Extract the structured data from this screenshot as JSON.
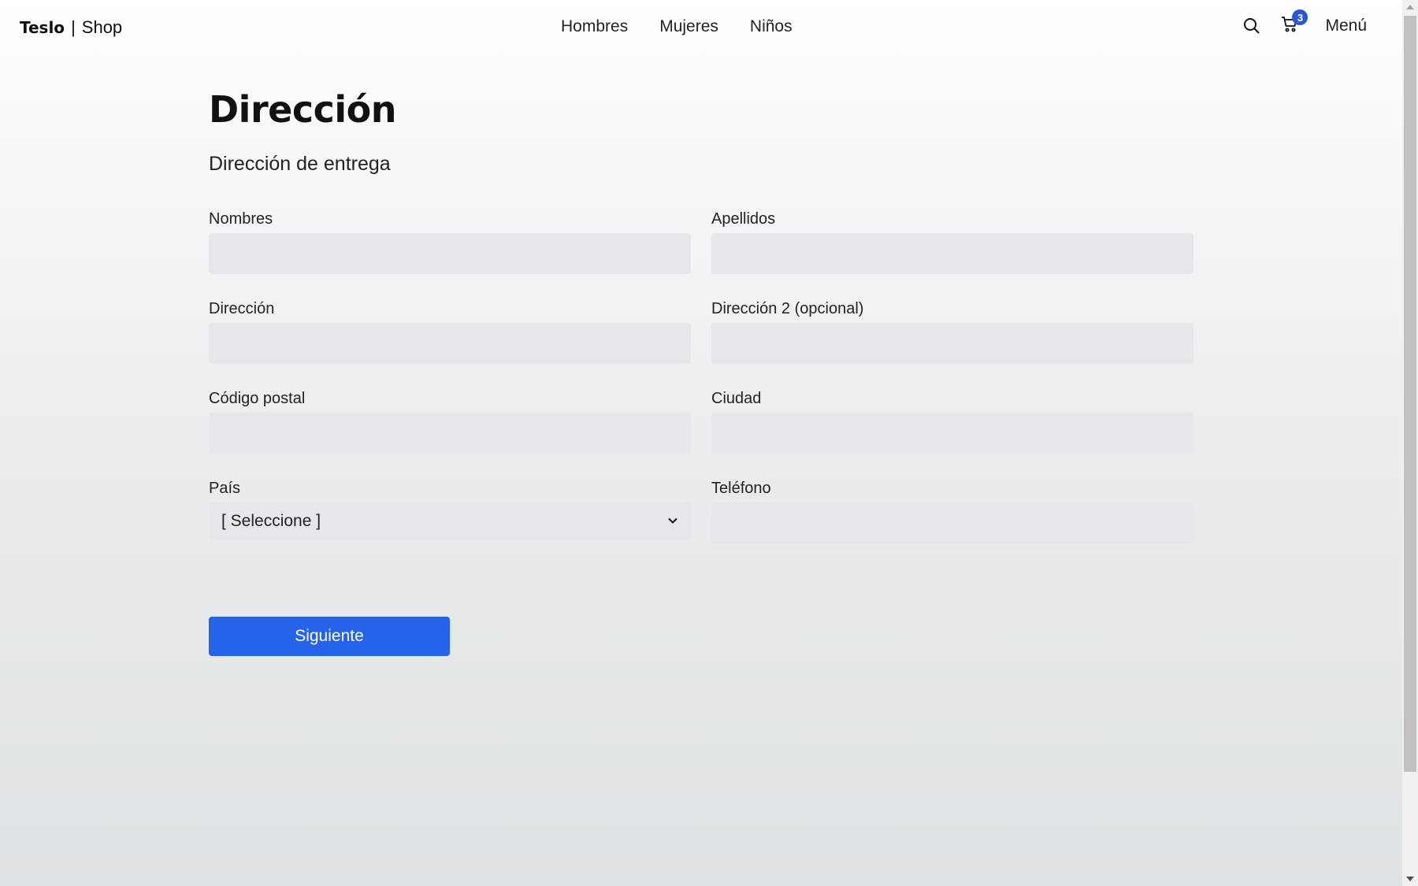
{
  "brand": {
    "bold": "Teslo",
    "separator": "|",
    "light": "Shop"
  },
  "nav": {
    "links": [
      "Hombres",
      "Mujeres",
      "Niños"
    ]
  },
  "header": {
    "cart_count": "3",
    "menu_label": "Menú",
    "icons": [
      "search-icon",
      "cart-icon"
    ]
  },
  "main": {
    "title": "Dirección",
    "subtitle": "Dirección de entrega",
    "fields": {
      "nombres": {
        "label": "Nombres",
        "value": ""
      },
      "apellidos": {
        "label": "Apellidos",
        "value": ""
      },
      "direccion": {
        "label": "Dirección",
        "value": ""
      },
      "direccion2": {
        "label": "Dirección 2 (opcional)",
        "value": ""
      },
      "codigo_postal": {
        "label": "Código postal",
        "value": ""
      },
      "ciudad": {
        "label": "Ciudad",
        "value": ""
      },
      "pais": {
        "label": "País",
        "selected": "[ Seleccione ]"
      },
      "telefono": {
        "label": "Teléfono",
        "value": ""
      }
    },
    "next_button": "Siguiente"
  },
  "colors": {
    "accent": "#2563eb",
    "badge": "#2c55d6",
    "input_bg": "#e5e7eb"
  }
}
